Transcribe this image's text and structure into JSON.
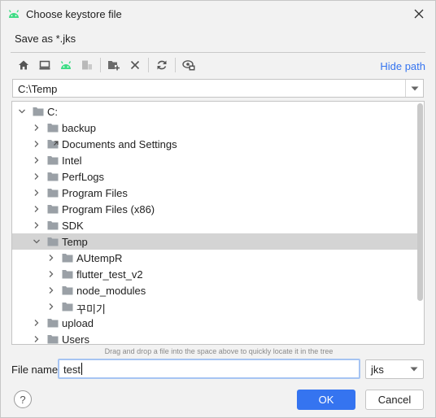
{
  "window": {
    "title": "Choose keystore file",
    "icon": "android-icon"
  },
  "subtitle": "Save as *.jks",
  "toolbar": {
    "buttons": [
      "home-icon",
      "desktop-icon",
      "android-project-icon",
      "module-icon",
      "new-folder-icon",
      "delete-icon",
      "refresh-icon",
      "show-hidden-icon"
    ],
    "hide_path_label": "Hide path"
  },
  "path": {
    "value": "C:\\Temp"
  },
  "tree": {
    "root": "C:",
    "items": [
      {
        "label": "backup",
        "level": 1,
        "expanded": false,
        "selected": false,
        "icon": "folder-icon"
      },
      {
        "label": "Documents and Settings",
        "level": 1,
        "expanded": false,
        "selected": false,
        "icon": "folder-link-icon"
      },
      {
        "label": "Intel",
        "level": 1,
        "expanded": false,
        "selected": false,
        "icon": "folder-icon"
      },
      {
        "label": "PerfLogs",
        "level": 1,
        "expanded": false,
        "selected": false,
        "icon": "folder-icon"
      },
      {
        "label": "Program Files",
        "level": 1,
        "expanded": false,
        "selected": false,
        "icon": "folder-icon"
      },
      {
        "label": "Program Files (x86)",
        "level": 1,
        "expanded": false,
        "selected": false,
        "icon": "folder-icon"
      },
      {
        "label": "SDK",
        "level": 1,
        "expanded": false,
        "selected": false,
        "icon": "folder-icon"
      },
      {
        "label": "Temp",
        "level": 1,
        "expanded": true,
        "selected": true,
        "icon": "folder-icon"
      },
      {
        "label": "AUtempR",
        "level": 2,
        "expanded": false,
        "selected": false,
        "icon": "folder-icon"
      },
      {
        "label": "flutter_test_v2",
        "level": 2,
        "expanded": false,
        "selected": false,
        "icon": "folder-icon"
      },
      {
        "label": "node_modules",
        "level": 2,
        "expanded": false,
        "selected": false,
        "icon": "folder-icon"
      },
      {
        "label": "꾸미기",
        "level": 2,
        "expanded": false,
        "selected": false,
        "icon": "folder-icon"
      },
      {
        "label": "upload",
        "level": 1,
        "expanded": false,
        "selected": false,
        "icon": "folder-icon"
      },
      {
        "label": "Users",
        "level": 1,
        "expanded": false,
        "selected": false,
        "icon": "folder-icon"
      }
    ]
  },
  "hint": "Drag and drop a file into the space above to quickly locate it in the tree",
  "file_name": {
    "label": "File name:",
    "value": "test"
  },
  "extension": {
    "selected": "jks"
  },
  "buttons": {
    "help": "?",
    "ok": "OK",
    "cancel": "Cancel"
  },
  "colors": {
    "accent": "#3574f0",
    "selection": "#d4d4d4",
    "android": "#3ddc84"
  }
}
